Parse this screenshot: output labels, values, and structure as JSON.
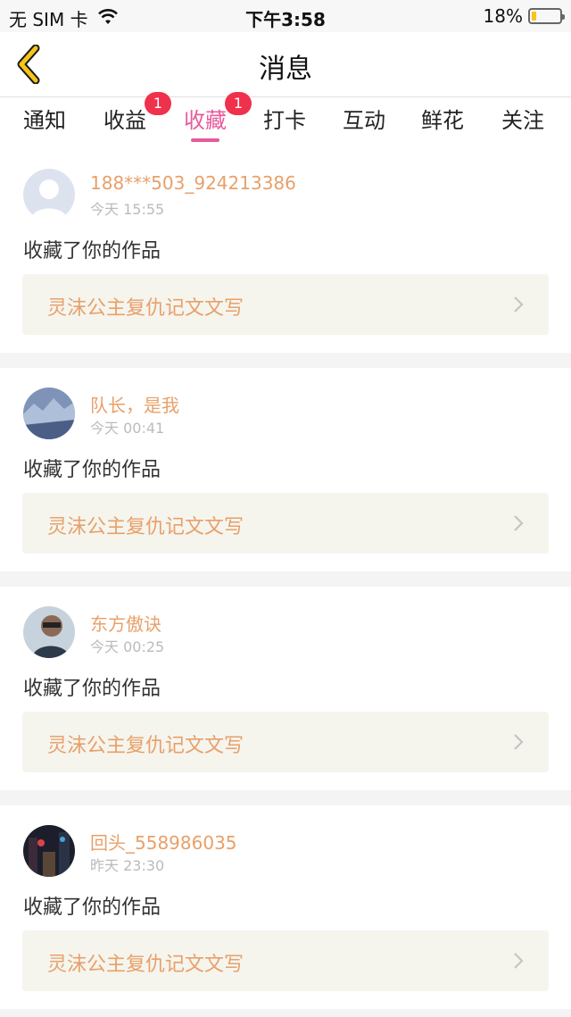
{
  "status_bar": {
    "carrier": "无 SIM 卡",
    "time": "下午3:58",
    "battery_text": "18%",
    "battery_level": 0.18
  },
  "nav": {
    "title": "消息"
  },
  "tabs": [
    {
      "label": "通知",
      "badge": ""
    },
    {
      "label": "收益",
      "badge": "1"
    },
    {
      "label": "收藏",
      "badge": "1",
      "active": true
    },
    {
      "label": "打卡",
      "badge": ""
    },
    {
      "label": "互动",
      "badge": ""
    },
    {
      "label": "鲜花",
      "badge": ""
    },
    {
      "label": "关注",
      "badge": ""
    }
  ],
  "messages": [
    {
      "user": "188***503_924213386",
      "time": "今天 15:55",
      "action": "收藏了你的作品",
      "work": "灵沫公主复仇记文文写",
      "avatar": "default-avatar"
    },
    {
      "user": "队长，是我",
      "time": "今天 00:41",
      "action": "收藏了你的作品",
      "work": "灵沫公主复仇记文文写",
      "avatar": "winter-landscape-avatar"
    },
    {
      "user": "东方傲诀",
      "time": "今天 00:25",
      "action": "收藏了你的作品",
      "work": "灵沫公主复仇记文文写",
      "avatar": "person-photo-avatar"
    },
    {
      "user": "回头_558986035",
      "time": "昨天 23:30",
      "action": "收藏了你的作品",
      "work": "灵沫公主复仇记文文写",
      "avatar": "night-city-avatar"
    }
  ],
  "colors": {
    "accent": "#e85a9c",
    "badge": "#f0314c",
    "username": "#e8a06a",
    "back_icon": "#f5c518"
  }
}
